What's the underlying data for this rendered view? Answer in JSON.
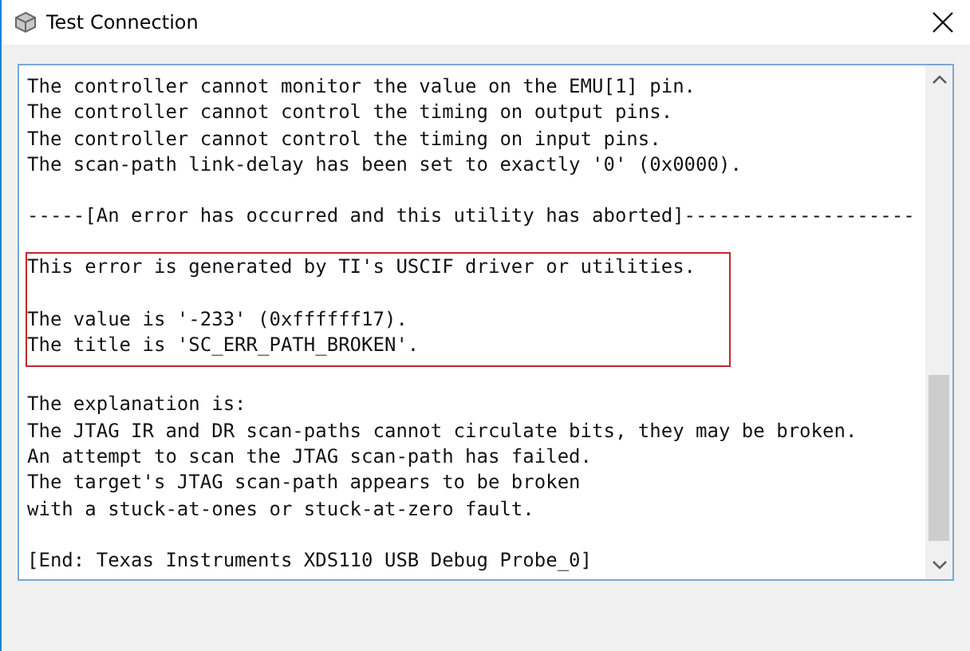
{
  "window": {
    "title": "Test Connection"
  },
  "output": {
    "sections": [
      {
        "boxed": false,
        "paragraphs": [
          [
            "The controller cannot monitor the value on the EMU[1] pin.",
            "The controller cannot control the timing on output pins.",
            "The controller cannot control the timing on input pins.",
            "The scan-path link-delay has been set to exactly '0' (0x0000)."
          ]
        ]
      },
      {
        "boxed": false,
        "paragraphs": [
          [
            "-----[An error has occurred and this utility has aborted]--------------------"
          ]
        ]
      },
      {
        "boxed": true,
        "paragraphs": [
          [
            "This error is generated by TI's USCIF driver or utilities."
          ],
          [
            "The value is '-233' (0xffffff17).",
            "The title is 'SC_ERR_PATH_BROKEN'."
          ]
        ]
      },
      {
        "boxed": false,
        "paragraphs": [
          [
            "The explanation is:",
            "The JTAG IR and DR scan-paths cannot circulate bits, they may be broken.",
            "An attempt to scan the JTAG scan-path has failed.",
            "The target's JTAG scan-path appears to be broken",
            "with a stuck-at-ones or stuck-at-zero fault."
          ]
        ]
      },
      {
        "boxed": false,
        "paragraphs": [
          [
            "[End: Texas Instruments XDS110 USB Debug Probe_0]"
          ]
        ]
      }
    ]
  }
}
